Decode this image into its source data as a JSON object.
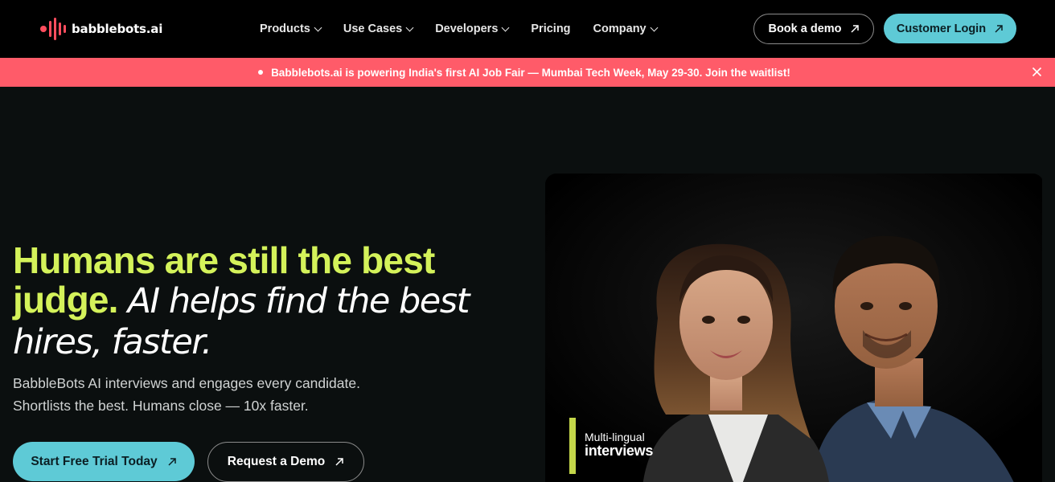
{
  "brand": {
    "name": "babblebots.ai",
    "logo_color": "#ff4d5e"
  },
  "nav": {
    "items": [
      {
        "label": "Products",
        "has_dropdown": true
      },
      {
        "label": "Use Cases",
        "has_dropdown": true
      },
      {
        "label": "Developers",
        "has_dropdown": true
      },
      {
        "label": "Pricing",
        "has_dropdown": false
      },
      {
        "label": "Company",
        "has_dropdown": true
      }
    ],
    "book_demo_label": "Book a demo",
    "login_label": "Customer Login"
  },
  "banner": {
    "text": "Babblebots.ai is powering India's first AI Job Fair — Mumbai Tech Week, May 29-30. Join the waitlist!",
    "background": "#ff5b69"
  },
  "hero": {
    "title_highlight": "Humans are still the best judge.",
    "title_rest": "AI helps find the best hires, faster.",
    "subtitle_line1": "BabbleBots AI interviews and engages every candidate.",
    "subtitle_line2": "Shortlists the best. Humans close — 10x faster.",
    "cta_primary": "Start Free Trial Today",
    "cta_secondary": "Request a Demo",
    "accent_color": "#d4f25a",
    "button_color": "#5ecad6"
  },
  "media": {
    "caption_line1": "Multi-lingual",
    "caption_line2": "interviews"
  },
  "icons": [
    "logo-icon",
    "chevron-down-icon",
    "arrow-up-right-icon",
    "close-icon"
  ]
}
